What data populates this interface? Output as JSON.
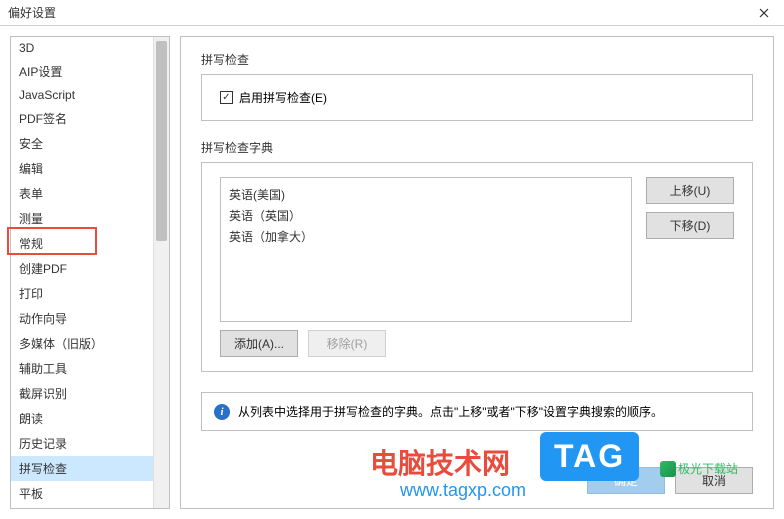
{
  "title": "偏好设置",
  "sidebar": {
    "items": [
      {
        "label": "3D"
      },
      {
        "label": "AIP设置"
      },
      {
        "label": "JavaScript"
      },
      {
        "label": "PDF签名"
      },
      {
        "label": "安全"
      },
      {
        "label": "编辑"
      },
      {
        "label": "表单"
      },
      {
        "label": "测量"
      },
      {
        "label": "常规"
      },
      {
        "label": "创建PDF"
      },
      {
        "label": "打印"
      },
      {
        "label": "动作向导"
      },
      {
        "label": "多媒体（旧版）"
      },
      {
        "label": "辅助工具"
      },
      {
        "label": "截屏识别"
      },
      {
        "label": "朗读"
      },
      {
        "label": "历史记录"
      },
      {
        "label": "拼写检查"
      },
      {
        "label": "平板"
      }
    ],
    "selected_index": 17,
    "highlighted_index": 8
  },
  "spellcheck": {
    "section_label": "拼写检查",
    "enable_label": "启用拼写检查(E)",
    "enable_checked": true
  },
  "dictionary": {
    "section_label": "拼写检查字典",
    "items": [
      {
        "label": "英语(美国)"
      },
      {
        "label": "英语（英国）"
      },
      {
        "label": "英语（加拿大）"
      }
    ],
    "move_up_label": "上移(U)",
    "move_down_label": "下移(D)",
    "add_label": "添加(A)...",
    "remove_label": "移除(R)"
  },
  "info_text": "从列表中选择用于拼写检查的字典。点击\"上移\"或者\"下移\"设置字典搜索的顺序。",
  "dialog_buttons": {
    "ok": "确定",
    "cancel": "取消"
  },
  "watermark": {
    "red_text": "电脑技术网",
    "tag": "TAG",
    "url": "www.tagxp.com",
    "jg": "极光下载站"
  }
}
